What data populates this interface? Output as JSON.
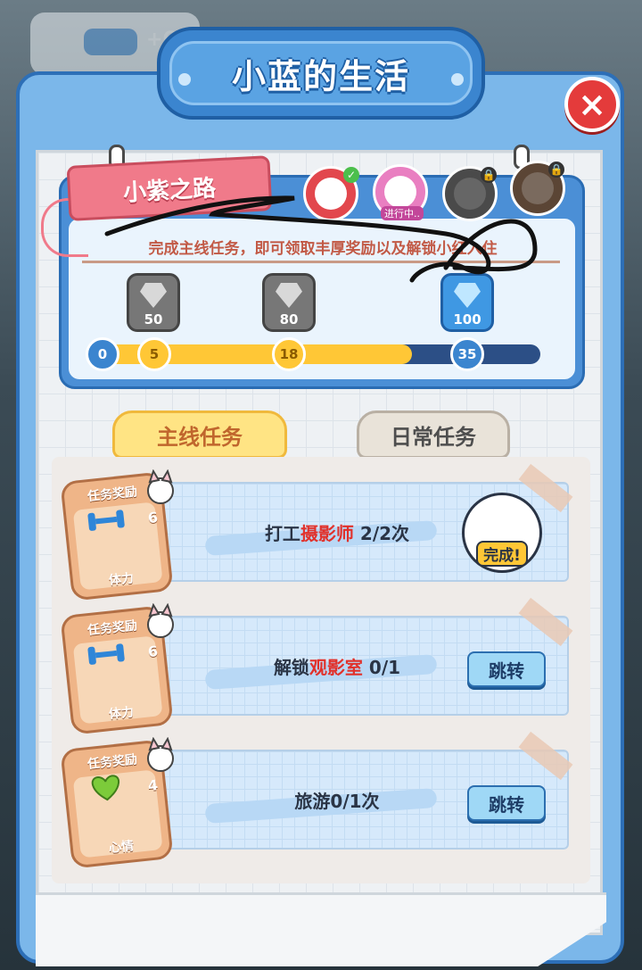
{
  "window": {
    "title": "小蓝的生活",
    "close_label": "×"
  },
  "road": {
    "tag_label": "小紫之路",
    "description": "完成主线任务，即可领取丰厚奖励以及解锁小红入住",
    "avatars": [
      {
        "name": "avatar-red",
        "status": "",
        "state": "completed"
      },
      {
        "name": "avatar-pink",
        "status": "进行中..",
        "state": "in-progress"
      },
      {
        "name": "avatar-dark",
        "status": "",
        "state": "locked"
      },
      {
        "name": "avatar-brown",
        "status": "",
        "state": "locked"
      }
    ],
    "gems": [
      {
        "value": "50",
        "type": "silver"
      },
      {
        "value": "80",
        "type": "silver"
      },
      {
        "value": "100",
        "type": "blue"
      }
    ],
    "progress": {
      "start": "0",
      "milestones": [
        "5",
        "18",
        "35"
      ],
      "fill_fraction": 0.71
    }
  },
  "tabs": [
    {
      "label": "主线任务",
      "active": true
    },
    {
      "label": "日常任务",
      "active": false
    }
  ],
  "tasks": [
    {
      "prefix": "打工",
      "highlight": "摄影师",
      "suffix": " 2/2次",
      "reward_title": "任务奖励",
      "reward_count": "6",
      "reward_label": "体力",
      "reward_icon": "dumbbell-icon",
      "status": "done",
      "status_label": "完成!"
    },
    {
      "prefix": "解锁",
      "highlight": "观影室",
      "suffix": " 0/1",
      "reward_title": "任务奖励",
      "reward_count": "6",
      "reward_label": "体力",
      "reward_icon": "dumbbell-icon",
      "status": "jump",
      "status_label": "跳转"
    },
    {
      "prefix": "旅游0/1次",
      "highlight": "",
      "suffix": "",
      "reward_title": "任务奖励",
      "reward_count": "4",
      "reward_label": "心情",
      "reward_icon": "heart-icon",
      "status": "jump",
      "status_label": "跳转"
    }
  ],
  "colors": {
    "frame": "#7bb7ea",
    "accent_gold": "#ffc736",
    "highlight_red": "#e1312b",
    "tag_pink": "#f07a8a"
  }
}
